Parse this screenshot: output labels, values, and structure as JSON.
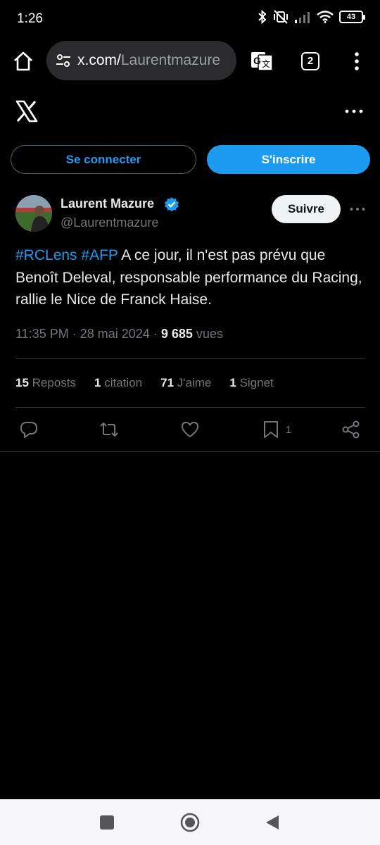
{
  "status_bar": {
    "time": "1:26",
    "battery_level": "43",
    "icons": [
      "bluetooth-icon",
      "vibrate-off-icon",
      "signal-icon",
      "wifi-icon",
      "battery-icon"
    ]
  },
  "browser": {
    "url_host": "x.com/",
    "url_path": "Laurentmazure",
    "tab_count": "2"
  },
  "auth": {
    "login_label": "Se connecter",
    "signup_label": "S'inscrire"
  },
  "tweet": {
    "author_name": "Laurent Mazure",
    "author_handle": "@Laurentmazure",
    "follow_label": "Suivre",
    "hashtag1": "#RCLens",
    "hashtag2": "#AFP",
    "text": " A ce jour, il n'est pas prévu que Benoît Deleval, responsable performance du Racing, rallie le Nice de Franck Haise.",
    "time": "11:35 PM",
    "date": "28 mai 2024",
    "views_count": "9 685",
    "views_label": "vues",
    "separator": "·"
  },
  "stats": {
    "reposts_count": "15",
    "reposts_label": "Reposts",
    "quotes_count": "1",
    "quotes_label": "citation",
    "likes_count": "71",
    "likes_label": "J'aime",
    "bookmarks_count": "1",
    "bookmarks_label": "Signet"
  },
  "actions": {
    "bookmark_count": "1"
  },
  "colors": {
    "accent": "#1d9bf0",
    "background": "#000000",
    "text": "#e7e9ea",
    "secondary_text": "#71767b",
    "divider": "#2f3336"
  }
}
